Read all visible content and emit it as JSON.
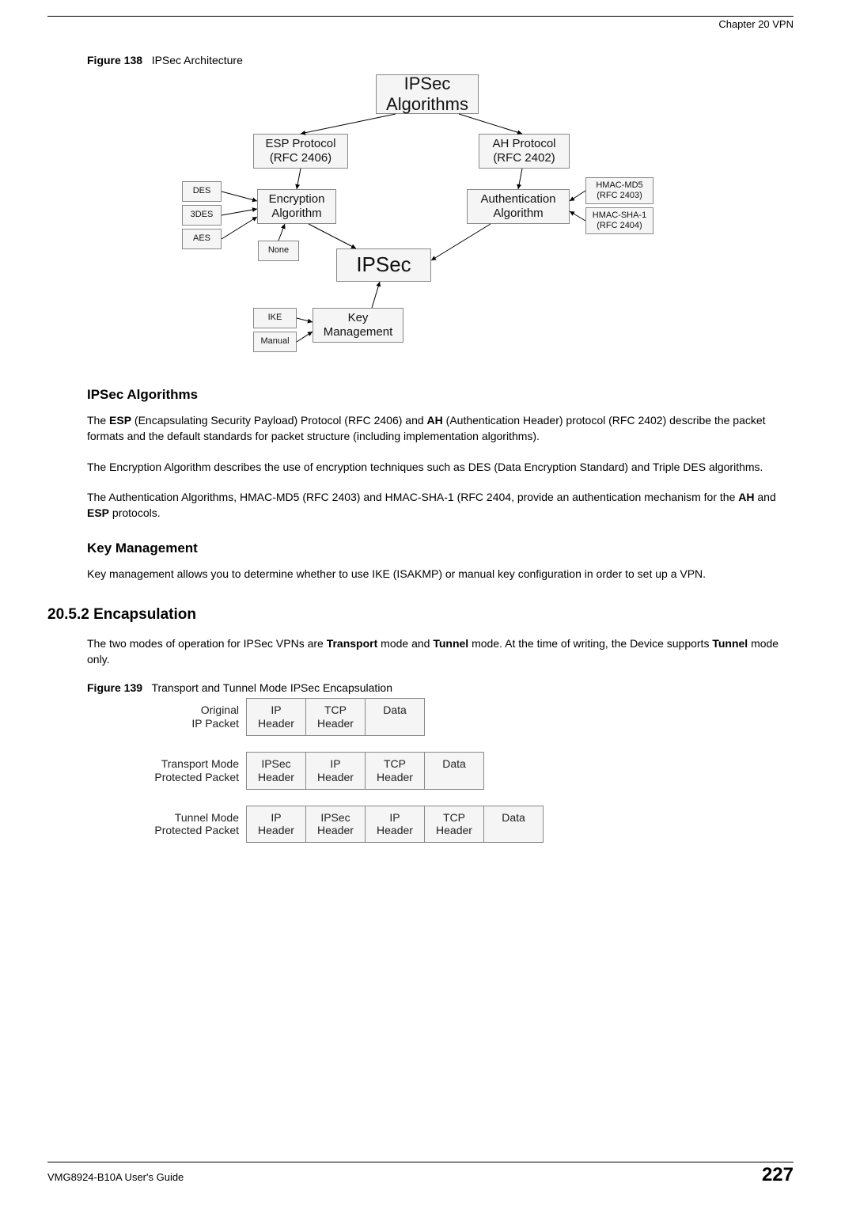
{
  "header": {
    "chapter": "Chapter 20 VPN"
  },
  "figure138": {
    "caption_label": "Figure 138",
    "caption_text": "IPSec Architecture",
    "boxes": {
      "ipsec_algorithms": "IPSec\nAlgorithms",
      "esp": "ESP Protocol\n(RFC 2406)",
      "ah": "AH Protocol\n(RFC 2402)",
      "encryption": "Encryption\nAlgorithm",
      "authentication": "Authentication\nAlgorithm",
      "des": "DES",
      "tdes": "3DES",
      "aes": "AES",
      "none": "None",
      "hmac_md5": "HMAC-MD5\n(RFC 2403)",
      "hmac_sha1": "HMAC-SHA-1\n(RFC 2404)",
      "ipsec": "IPSec",
      "key_mgmt": "Key\nManagement",
      "ike": "IKE",
      "manual": "Manual"
    }
  },
  "sections": {
    "ipsec_alg_head": "IPSec Algorithms",
    "ipsec_alg_p1_a": "The ",
    "ipsec_alg_p1_b": "ESP",
    "ipsec_alg_p1_c": " (Encapsulating Security Payload) Protocol (RFC 2406) and ",
    "ipsec_alg_p1_d": "AH",
    "ipsec_alg_p1_e": " (Authentication Header) protocol (RFC 2402) describe the packet formats and the default standards for packet structure (including implementation algorithms).",
    "ipsec_alg_p2": "The Encryption Algorithm describes the use of encryption techniques such as DES (Data Encryption Standard) and Triple DES algorithms.",
    "ipsec_alg_p3_a": "The Authentication Algorithms, HMAC-MD5 (RFC 2403) and HMAC-SHA-1 (RFC 2404, provide an authentication mechanism for the ",
    "ipsec_alg_p3_b": "AH",
    "ipsec_alg_p3_c": " and ",
    "ipsec_alg_p3_d": "ESP",
    "ipsec_alg_p3_e": " protocols.",
    "keymgmt_head": "Key Management",
    "keymgmt_p1": "Key management allows you to determine whether to use IKE (ISAKMP) or manual key configuration in order to set up a VPN.",
    "encaps_num": "20.5.2  Encapsulation",
    "encaps_p1_a": "The two modes of operation for IPSec VPNs are ",
    "encaps_p1_b": "Transport",
    "encaps_p1_c": " mode and ",
    "encaps_p1_d": "Tunnel",
    "encaps_p1_e": " mode. At the time of writing, the Device supports ",
    "encaps_p1_f": "Tunnel",
    "encaps_p1_g": " mode only."
  },
  "figure139": {
    "caption_label": "Figure 139",
    "caption_text": "Transport and Tunnel Mode IPSec Encapsulation",
    "rows": [
      {
        "label": "Original\nIP Packet",
        "cells": [
          "IP\nHeader",
          "TCP\nHeader",
          "Data"
        ]
      },
      {
        "label": "Transport Mode\nProtected Packet",
        "cells": [
          "IPSec\nHeader",
          "IP\nHeader",
          "TCP\nHeader",
          "Data"
        ]
      },
      {
        "label": "Tunnel Mode\nProtected Packet",
        "cells": [
          "IP\nHeader",
          "IPSec\nHeader",
          "IP\nHeader",
          "TCP\nHeader",
          "Data"
        ]
      }
    ]
  },
  "footer": {
    "guide": "VMG8924-B10A User's Guide",
    "page": "227"
  }
}
